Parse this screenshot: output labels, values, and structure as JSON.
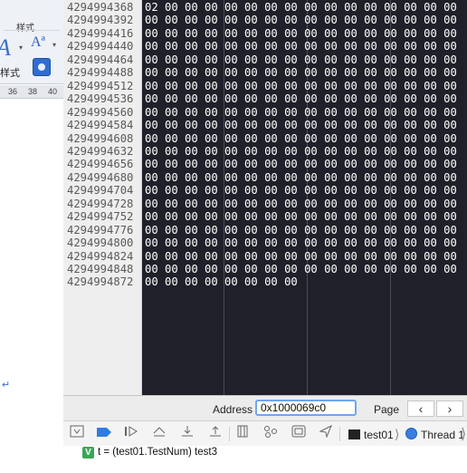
{
  "ribbon": {
    "group_label": "样式",
    "styles_label": "样式",
    "ruler_ticks": [
      "36",
      "38",
      "40"
    ]
  },
  "memory": {
    "addresses": [
      "4294994368",
      "4294994392",
      "4294994416",
      "4294994440",
      "4294994464",
      "4294994488",
      "4294994512",
      "4294994536",
      "4294994560",
      "4294994584",
      "4294994608",
      "4294994632",
      "4294994656",
      "4294994680",
      "4294994704",
      "4294994728",
      "4294994752",
      "4294994776",
      "4294994800",
      "4294994824",
      "4294994848",
      "4294994872"
    ],
    "rows": [
      "02 00 00 00 00 00 00 00 00 00 00 00 00 00 00 00",
      "00 00 00 00 00 00 00 00 00 00 00 00 00 00 00 00",
      "00 00 00 00 00 00 00 00 00 00 00 00 00 00 00 00",
      "00 00 00 00 00 00 00 00 00 00 00 00 00 00 00 00",
      "00 00 00 00 00 00 00 00 00 00 00 00 00 00 00 00",
      "00 00 00 00 00 00 00 00 00 00 00 00 00 00 00 00",
      "00 00 00 00 00 00 00 00 00 00 00 00 00 00 00 00",
      "00 00 00 00 00 00 00 00 00 00 00 00 00 00 00 00",
      "00 00 00 00 00 00 00 00 00 00 00 00 00 00 00 00",
      "00 00 00 00 00 00 00 00 00 00 00 00 00 00 00 00",
      "00 00 00 00 00 00 00 00 00 00 00 00 00 00 00 00",
      "00 00 00 00 00 00 00 00 00 00 00 00 00 00 00 00",
      "00 00 00 00 00 00 00 00 00 00 00 00 00 00 00 00",
      "00 00 00 00 00 00 00 00 00 00 00 00 00 00 00 00",
      "00 00 00 00 00 00 00 00 00 00 00 00 00 00 00 00",
      "00 00 00 00 00 00 00 00 00 00 00 00 00 00 00 00",
      "00 00 00 00 00 00 00 00 00 00 00 00 00 00 00 00",
      "00 00 00 00 00 00 00 00 00 00 00 00 00 00 00 00",
      "00 00 00 00 00 00 00 00 00 00 00 00 00 00 00 00",
      "00 00 00 00 00 00 00 00 00 00 00 00 00 00 00 00",
      "00 00 00 00 00 00 00 00 00 00 00 00 00 00 00 00",
      "00 00 00 00 00 00 00 00"
    ]
  },
  "address_bar": {
    "label": "Address",
    "value": "0x1000069c0",
    "page_label": "Page",
    "prev_icon": "chevron-left-icon",
    "next_icon": "chevron-right-icon"
  },
  "debug_toolbar": {
    "process": "test01",
    "thread": "Thread 1"
  },
  "variable": {
    "badge": "V",
    "text": "t = (test01.TestNum) test3"
  }
}
